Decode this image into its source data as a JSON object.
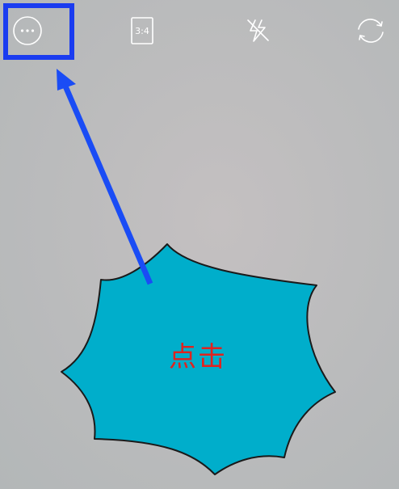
{
  "toolbar": {
    "more": {
      "icon": "more-icon"
    },
    "aspect_ratio": {
      "label": "3:4",
      "icon": "aspect-ratio-icon"
    },
    "flash": {
      "icon": "flash-off-icon"
    },
    "switch_camera": {
      "icon": "switch-camera-icon"
    }
  },
  "annotation": {
    "callout_text": "点击",
    "highlight_color": "#1a3cf0",
    "arrow_color": "#1a4cf5",
    "burst_color": "#00aecb",
    "text_color": "#e0231f"
  }
}
